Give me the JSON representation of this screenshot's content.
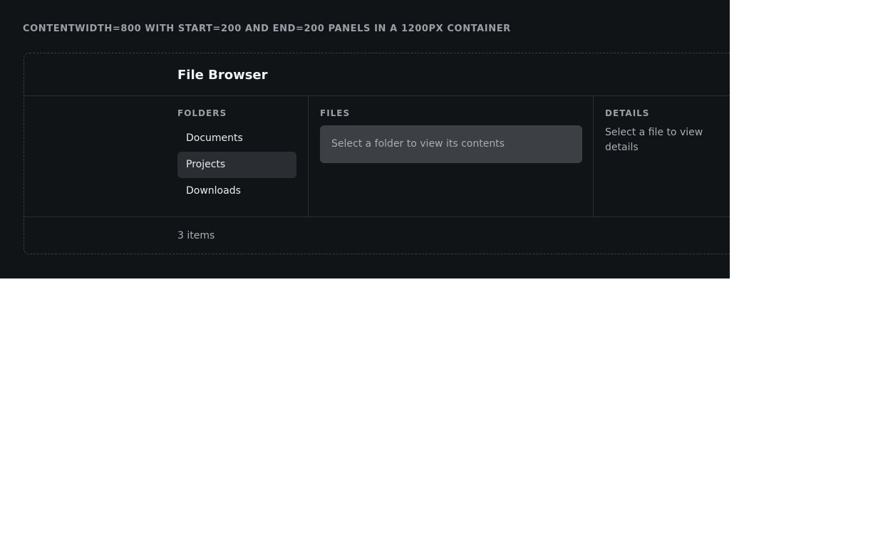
{
  "caption": "contentWidth=800 with start=200 and end=200 panels in a 1200px container",
  "app": {
    "title": "File Browser"
  },
  "folders": {
    "title": "Folders",
    "items": [
      {
        "label": "Documents",
        "selected": false
      },
      {
        "label": "Projects",
        "selected": true
      },
      {
        "label": "Downloads",
        "selected": false
      }
    ]
  },
  "files": {
    "title": "Files",
    "empty_message": "Select a folder to view its contents"
  },
  "details": {
    "title": "Details",
    "empty_message": "Select a file to view details"
  },
  "footer": {
    "count": "3 items"
  },
  "colors": {
    "background": "#111416",
    "border": "#2a2e32",
    "selected": "#2a2e32",
    "empty_box": "#3c4045"
  }
}
